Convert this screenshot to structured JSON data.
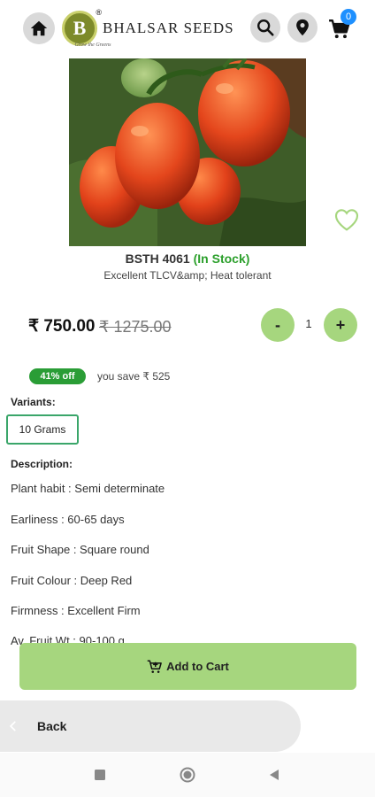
{
  "header": {
    "brand_name": "BHALSAR SEEDS",
    "brand_letter": "B",
    "brand_reg": "®",
    "brand_tagline": "Grow the Greens",
    "cart_count": "0",
    "icons": [
      "home-icon",
      "search-icon",
      "location-icon",
      "cart-icon"
    ]
  },
  "product": {
    "name": "BSTH 4061",
    "stock_status": "(In Stock)",
    "tagline": "Excellent TLCV&amp; Heat tolerant",
    "price": "₹ 750.00",
    "mrp": "₹ 1275.00",
    "quantity": "1",
    "qty_minus_label": "-",
    "qty_plus_label": "+",
    "discount": "41% off",
    "savings": "you save ₹ 525"
  },
  "variants": {
    "label": "Variants:",
    "selected": "10 Grams"
  },
  "description": {
    "label": "Description:",
    "lines": [
      "Plant habit : Semi determinate",
      "Earliness : 60-65 days",
      "Fruit Shape : Square round",
      "Fruit Colour : Deep Red",
      "Firmness : Excellent Firm",
      "Av. Fruit Wt : 90-100 g"
    ]
  },
  "actions": {
    "add_to_cart": "Add to Cart",
    "back": "Back"
  },
  "colors": {
    "accent_green": "#a6d67e",
    "stock_green": "#2ca02c",
    "badge_green": "#2a9d36",
    "cart_badge_blue": "#1e90ff"
  }
}
